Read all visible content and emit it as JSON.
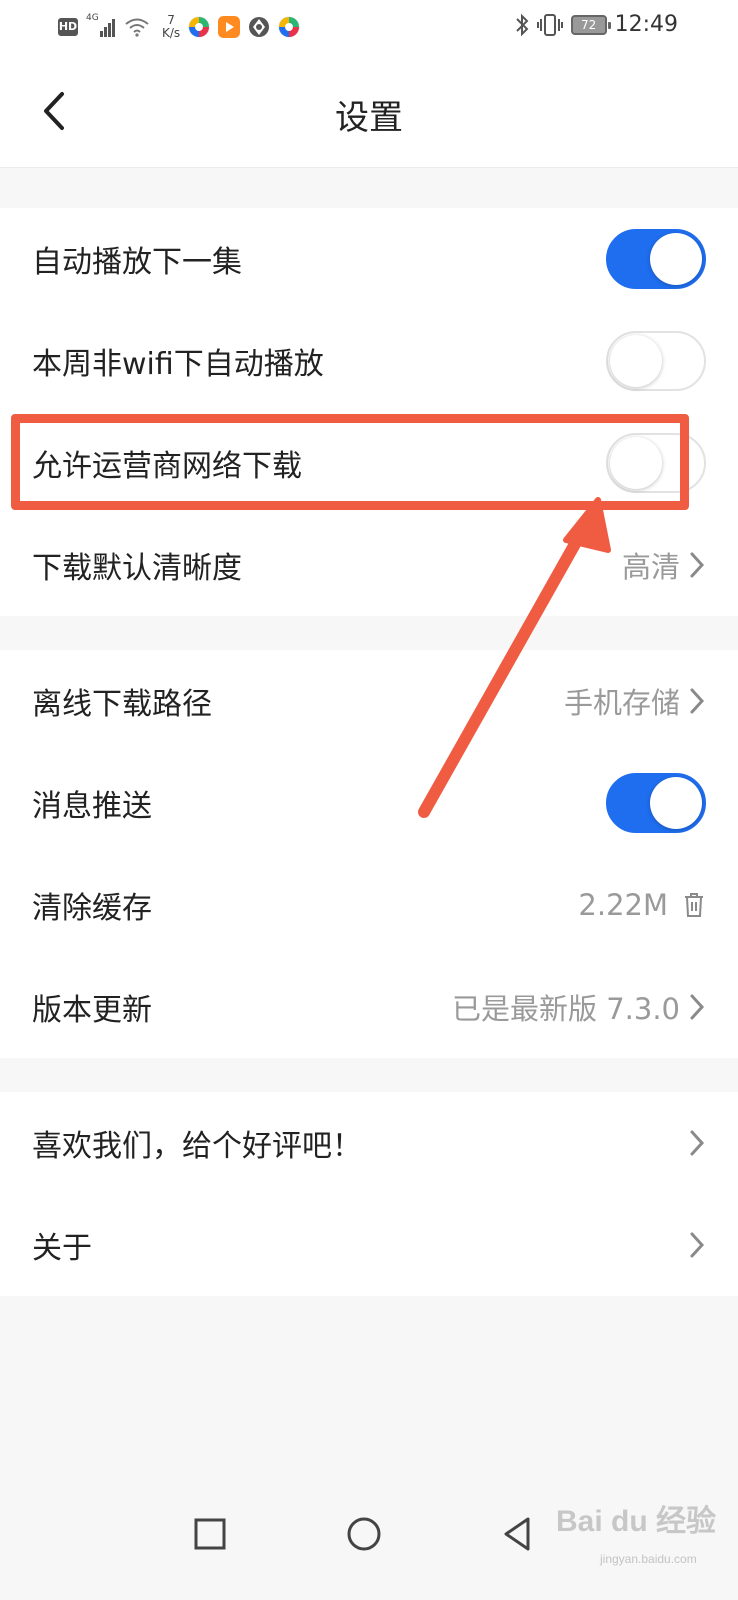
{
  "status_bar": {
    "hd": "HD",
    "network_type": "4G",
    "speed_value": "7",
    "speed_unit": "K/s",
    "battery": "72",
    "time": "12:49",
    "colors": {
      "app_orange": "#ff8a1f"
    }
  },
  "header": {
    "title": "设置",
    "back_icon": "chevron-left-icon"
  },
  "groups": [
    {
      "items": [
        {
          "label": "自动播放下一集",
          "control": "toggle",
          "state": "on"
        },
        {
          "label": "本周非wifi下自动播放",
          "control": "toggle",
          "state": "off"
        },
        {
          "label": "允许运营商网络下载",
          "control": "toggle",
          "state": "off"
        },
        {
          "label": "下载默认清晰度",
          "control": "value-chevron",
          "value": "高清"
        }
      ]
    },
    {
      "items": [
        {
          "label": "离线下载路径",
          "control": "value-chevron",
          "value": "手机存储"
        },
        {
          "label": "消息推送",
          "control": "toggle",
          "state": "on"
        },
        {
          "label": "清除缓存",
          "control": "value-trash",
          "value": "2.22M"
        },
        {
          "label": "版本更新",
          "control": "value-chevron",
          "value": "已是最新版 7.3.0"
        }
      ]
    },
    {
      "items": [
        {
          "label": "喜欢我们，给个好评吧！",
          "control": "chevron"
        },
        {
          "label": "关于",
          "control": "chevron"
        }
      ]
    }
  ],
  "annotation": {
    "highlighted_item": "允许运营商网络下载",
    "color": "#f05c42"
  },
  "nav_bar": {
    "buttons": [
      "recent-apps-icon",
      "home-icon",
      "back-icon"
    ]
  },
  "watermark": {
    "text": "Bai du 经验",
    "sub": "jingyan.baidu.com"
  },
  "colors": {
    "accent": "#1f6ef0",
    "secondary_text": "#9a9a9a"
  }
}
